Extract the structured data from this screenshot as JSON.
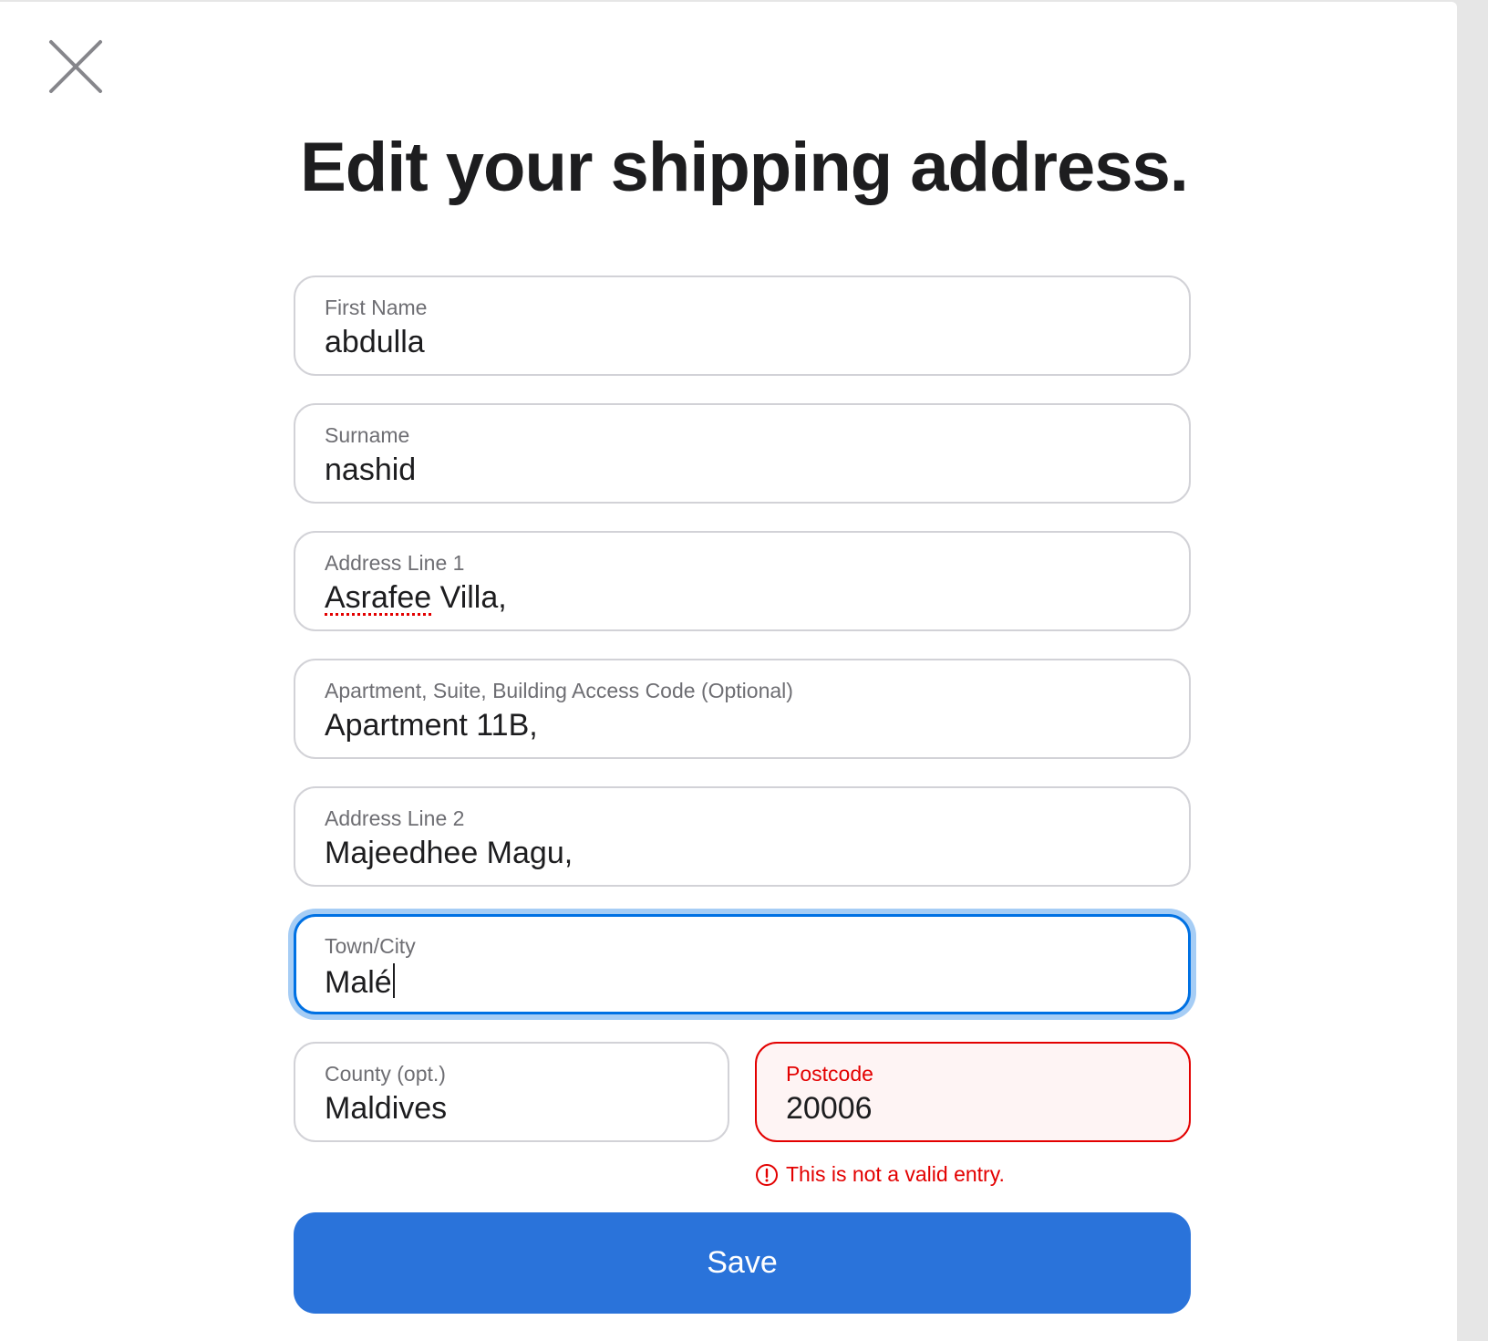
{
  "title": "Edit your shipping address.",
  "fields": {
    "first_name": {
      "label": "First Name",
      "value": "abdulla"
    },
    "surname": {
      "label": "Surname",
      "value": "nashid"
    },
    "address_line_1": {
      "label": "Address Line 1",
      "value_word1": "Asrafee",
      "value_rest": " Villa,"
    },
    "apartment": {
      "label": "Apartment, Suite, Building Access Code (Optional)",
      "value": "Apartment 11B,"
    },
    "address_line_2": {
      "label": "Address Line 2",
      "value": "Majeedhee Magu,"
    },
    "town_city": {
      "label": "Town/City",
      "value": "Malé"
    },
    "county": {
      "label": "County (opt.)",
      "value": "Maldives"
    },
    "postcode": {
      "label": "Postcode",
      "value": "20006"
    }
  },
  "postcode_error": "This is not a valid entry.",
  "save_label": "Save",
  "colors": {
    "accent": "#0071e3",
    "button": "#2a73da",
    "error": "#e30000",
    "error_bg": "#fef4f4"
  },
  "icons": {
    "close": "close-icon",
    "error": "alert-circle-icon"
  }
}
